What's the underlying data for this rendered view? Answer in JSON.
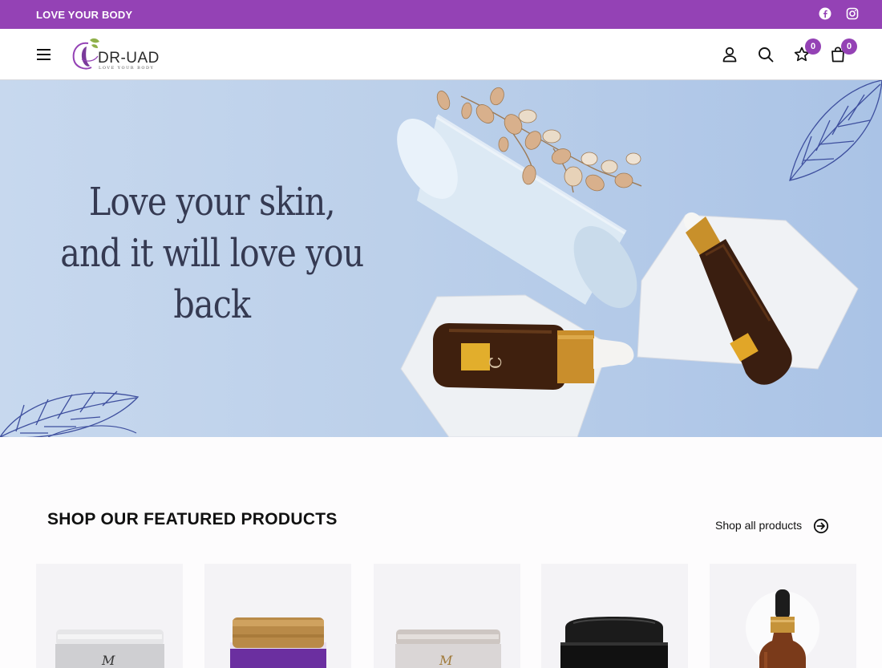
{
  "announcement": {
    "text": "LOVE YOUR BODY"
  },
  "header": {
    "logo_name": "DR-UAD",
    "logo_tagline": "LOVE YOUR BODY",
    "wishlist_count": "0",
    "cart_count": "0"
  },
  "icons": {
    "social": [
      "facebook-icon",
      "instagram-icon"
    ],
    "header": [
      "menu-icon",
      "account-icon",
      "search-icon",
      "star-icon",
      "bag-icon"
    ]
  },
  "hero": {
    "line1": "Love your skin,",
    "line2": "and it will love you back"
  },
  "featured": {
    "title": "SHOP OUR FEATURED PRODUCTS",
    "shop_all": "Shop all products",
    "products": [
      {
        "name": "",
        "kind": "white-jar"
      },
      {
        "name": "",
        "kind": "gold-lid-jar"
      },
      {
        "name": "",
        "kind": "white-jar"
      },
      {
        "name": "",
        "kind": "black-jar"
      },
      {
        "name": "",
        "kind": "dropper-bottle"
      }
    ]
  },
  "colors": {
    "brand_purple": "#9442b5",
    "hero_blue": "#bcd0ea",
    "headline": "#353a52"
  }
}
